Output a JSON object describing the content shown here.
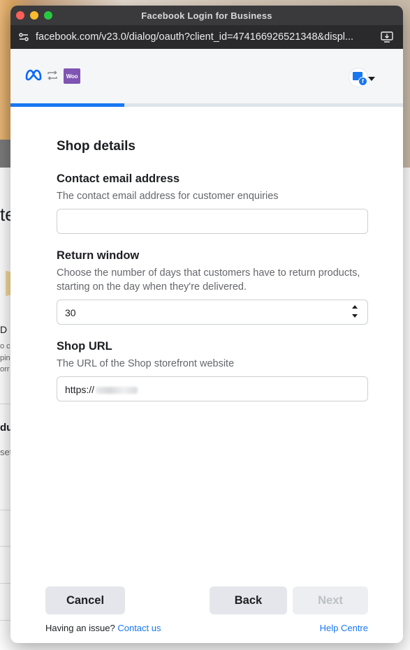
{
  "window": {
    "title": "Facebook Login for Business",
    "url": "facebook.com/v23.0/dialog/oauth?client_id=474166926521348&displ..."
  },
  "background_fragments": [
    "te",
    "D",
    "o c",
    "pin",
    "orr",
    "du",
    "set"
  ],
  "header": {
    "woo_badge": "Woo",
    "progress_fraction": 0.29
  },
  "form": {
    "section_title": "Shop details",
    "contact_email": {
      "label": "Contact email address",
      "help": "The contact email address for customer enquiries",
      "value": ""
    },
    "return_window": {
      "label": "Return window",
      "help": "Choose the number of days that customers have to return products, starting on the day when they're delivered.",
      "value": "30"
    },
    "shop_url": {
      "label": "Shop URL",
      "help": "The URL of the Shop storefront website",
      "value_prefix": "https://"
    }
  },
  "buttons": {
    "cancel": "Cancel",
    "back": "Back",
    "next": "Next"
  },
  "footer": {
    "issue_text": "Having an issue?",
    "contact_link": "Contact us",
    "help_link": "Help Centre"
  },
  "colors": {
    "accent": "#1877f2",
    "woo_purple": "#7f54b3",
    "titlebar": "#3a3a3c"
  }
}
